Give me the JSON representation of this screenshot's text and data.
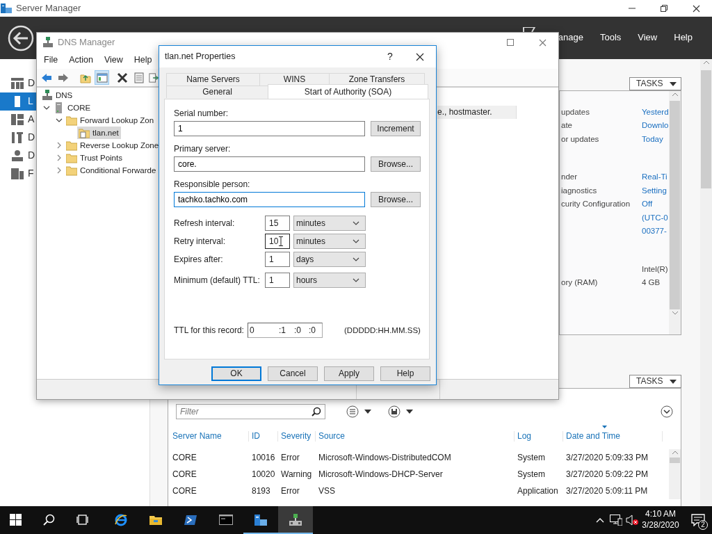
{
  "server_manager": {
    "title": "Server Manager",
    "menu": [
      "anage",
      "Tools",
      "View",
      "Help"
    ],
    "sidebar": [
      {
        "label": "D",
        "selected": false
      },
      {
        "label": "L",
        "selected": true
      },
      {
        "label": "A",
        "selected": false
      },
      {
        "label": "D",
        "selected": false
      },
      {
        "label": "D",
        "selected": false
      },
      {
        "label": "F",
        "selected": false
      }
    ],
    "properties": {
      "tasks": "TASKS",
      "groups": [
        [
          {
            "label": "updates",
            "value": "Yesterd",
            "kind": "link"
          },
          {
            "label": "ate",
            "value": "Downlo",
            "kind": "link"
          },
          {
            "label": "or updates",
            "value": "Today",
            "kind": "link"
          }
        ],
        [
          {
            "label": "nder",
            "value": "Real-Ti",
            "kind": "link"
          },
          {
            "label": "iagnostics",
            "value": "Setting",
            "kind": "link"
          },
          {
            "label": "curity Configuration",
            "value": "Off",
            "kind": "link"
          },
          {
            "value": "(UTC-0",
            "kind": "link"
          },
          {
            "value": "00377-",
            "kind": "link"
          }
        ],
        [
          {
            "value": "Intel(R)",
            "kind": "text"
          },
          {
            "label": "ory (RAM)",
            "value": "4 GB",
            "kind": "text"
          }
        ]
      ]
    },
    "events": {
      "tasks": "TASKS",
      "filter": {
        "placeholder": "Filter"
      },
      "columns": [
        {
          "label": "Server Name",
          "sorted": false
        },
        {
          "label": "ID",
          "sorted": false
        },
        {
          "label": "Severity",
          "sorted": false
        },
        {
          "label": "Source",
          "sorted": false
        },
        {
          "label": "Log",
          "sorted": false
        },
        {
          "label": "Date and Time",
          "sorted": true
        }
      ],
      "rows": [
        [
          "CORE",
          "10016",
          "Error",
          "Microsoft-Windows-DistributedCOM",
          "System",
          "3/27/2020 5:09:33 PM"
        ],
        [
          "CORE",
          "10020",
          "Warning",
          "Microsoft-Windows-DHCP-Server",
          "System",
          "3/27/2020 5:09:22 PM"
        ],
        [
          "CORE",
          "8193",
          "Error",
          "VSS",
          "Application",
          "3/27/2020 5:09:11 PM"
        ]
      ]
    }
  },
  "dns_manager": {
    "title": "DNS Manager",
    "menu": [
      "File",
      "Action",
      "View",
      "Help"
    ],
    "tree": [
      {
        "label": "DNS",
        "selected": false,
        "children": [
          {
            "label": "CORE",
            "selected": false,
            "expanded": true,
            "children": [
              {
                "label": "Forward Lookup Zon",
                "selected": false,
                "expanded": true,
                "children": [
                  {
                    "label": "tlan.net",
                    "selected": true
                  }
                ]
              },
              {
                "label": "Reverse Lookup Zone",
                "selected": false,
                "expanded": false
              },
              {
                "label": "Trust Points",
                "selected": false,
                "expanded": false
              },
              {
                "label": "Conditional Forwarde",
                "selected": false,
                "expanded": false
              }
            ]
          }
        ]
      }
    ],
    "record_text": "e., hostmaster."
  },
  "dialog": {
    "title": "tlan.net Properties",
    "help": "?",
    "tabs": [
      [
        {
          "label": "Name Servers",
          "selected": false
        },
        {
          "label": "WINS",
          "selected": false
        },
        {
          "label": "Zone Transfers",
          "selected": false
        }
      ],
      [
        {
          "label": "General",
          "selected": false
        },
        {
          "label": "Start of Authority (SOA)",
          "selected": true
        }
      ]
    ],
    "fields": [
      {
        "label": "Serial number:",
        "value": "1",
        "button": "Increment",
        "focused": false
      },
      {
        "label": "Primary server:",
        "value": "core.",
        "button": "Browse...",
        "focused": false
      },
      {
        "label": "Responsible person:",
        "value": "tachko.tachko.com",
        "button": "Browse...",
        "focused": true
      }
    ],
    "intervals": [
      {
        "label": "Refresh interval:",
        "value": "15",
        "unit": "minutes",
        "focused": false
      },
      {
        "label": "Retry interval:",
        "value": "10",
        "unit": "minutes",
        "focused": true
      },
      {
        "label": "Expires after:",
        "value": "1",
        "unit": "days",
        "focused": false
      },
      {
        "label": "Minimum (default) TTL:",
        "value": "1",
        "unit": "hours",
        "focused": false
      }
    ],
    "ttl": {
      "label": "TTL for this record:",
      "parts": [
        "0",
        ":1",
        ":0",
        ":0"
      ],
      "hint": "(DDDDD:HH.MM.SS)"
    },
    "buttons": [
      {
        "label": "OK",
        "default": true
      },
      {
        "label": "Cancel",
        "default": false
      },
      {
        "label": "Apply",
        "default": false
      },
      {
        "label": "Help",
        "default": false
      }
    ]
  },
  "taskbar": {
    "apps": [
      {
        "kind": "start",
        "running": false,
        "active": false
      },
      {
        "kind": "search",
        "running": false,
        "active": false
      },
      {
        "kind": "taskview",
        "running": false,
        "active": false
      },
      {
        "kind": "browser",
        "running": false,
        "active": false
      },
      {
        "kind": "explorer",
        "running": false,
        "active": false
      },
      {
        "kind": "powershell",
        "running": false,
        "active": false
      },
      {
        "kind": "cmd",
        "running": false,
        "active": false
      },
      {
        "kind": "servermanager",
        "running": true,
        "active": false
      },
      {
        "kind": "dns",
        "running": true,
        "active": true
      }
    ],
    "time": "4:10 AM",
    "date": "3/28/2020",
    "notifications": "2"
  }
}
